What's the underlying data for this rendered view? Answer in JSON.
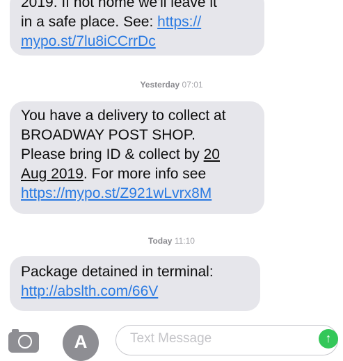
{
  "messages": [
    {
      "lines": [
        "2019. If not home we'll leave it",
        "in a safe place. See: "
      ],
      "link_part1": "https://",
      "link_part2": "mypo.st/7lu8iCCrrDc"
    },
    {
      "line1": "You have a delivery to collect at",
      "line2": "BROADWAY POST SHOP.",
      "line3": "Please bring ID & collect by ",
      "date_part1": "20",
      "date_part2": "Aug 2019",
      "line4_rest": ". For more info see",
      "link": "https://mypo.st/Z921wLvrx8M"
    },
    {
      "line1": "Package detained in terminal:",
      "link": "http://abslth.com/66V"
    }
  ],
  "timestamps": [
    {
      "day": "Yesterday",
      "time": "07:01"
    },
    {
      "day": "Today",
      "time": "11:10"
    }
  ],
  "input_bar": {
    "placeholder": "Text Message",
    "camera_icon": "camera-icon",
    "appstore_icon": "app-store-icon",
    "appstore_glyph": "A",
    "send_icon": "send-arrow-icon",
    "send_glyph": "↑"
  },
  "colors": {
    "bubble_bg": "#e6e6eb",
    "link": "#2a7ae2",
    "send": "#34c759"
  }
}
